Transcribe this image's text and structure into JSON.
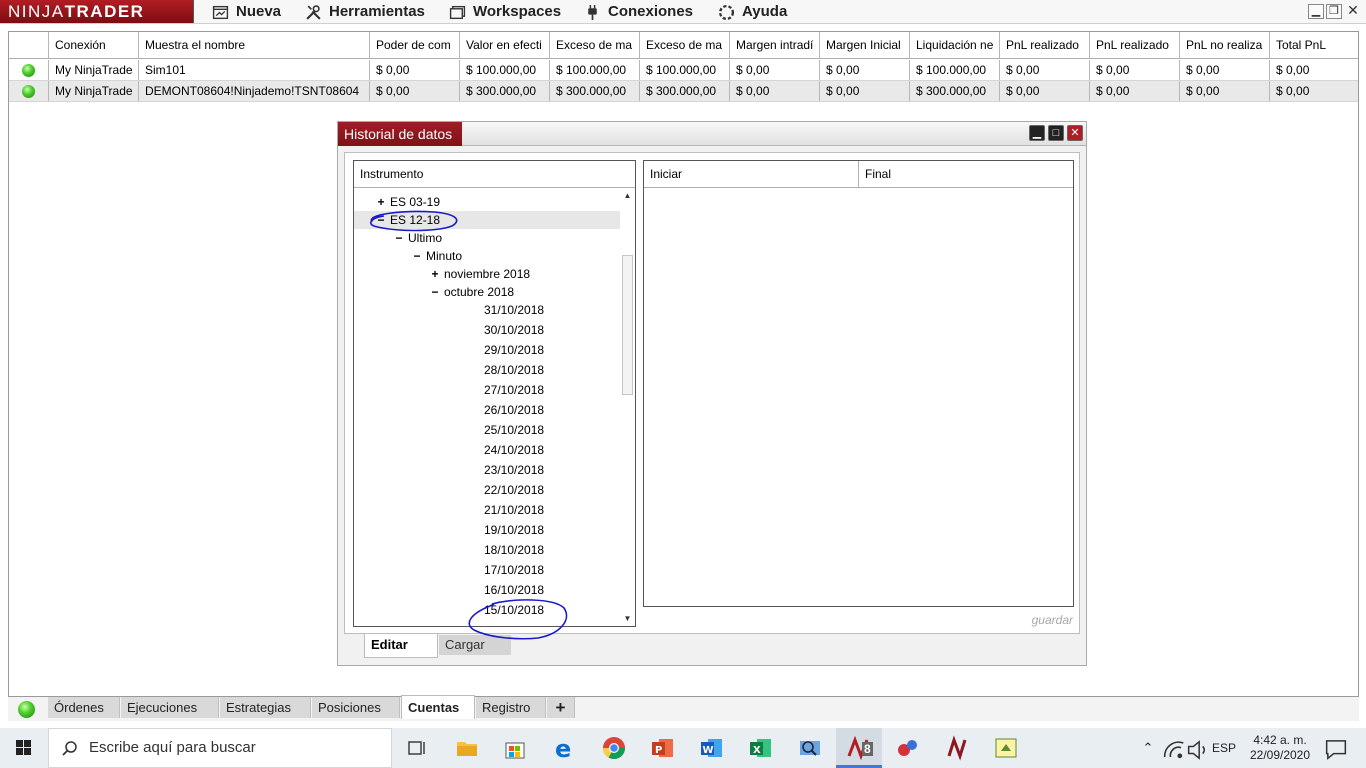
{
  "app": {
    "logo_light": "NINJA",
    "logo_bold": "TRADER",
    "menu": [
      "Nueva",
      "Herramientas",
      "Workspaces",
      "Conexiones",
      "Ayuda"
    ],
    "window_controls": [
      "minimize",
      "restore",
      "close"
    ]
  },
  "accounts": {
    "columns": [
      "",
      "Conexión",
      "Muestra el nombre",
      "Poder de com",
      "Valor en efecti",
      "Exceso de ma",
      "Exceso de ma",
      "Margen intradí",
      "Margen Inicial",
      "Liquidación ne",
      "PnL realizado",
      "PnL realizado",
      "PnL no realiza",
      "Total PnL"
    ],
    "rows": [
      [
        "",
        "My NinjaTrade",
        "Sim101",
        "$ 0,00",
        "$ 100.000,00",
        "$ 100.000,00",
        "$ 100.000,00",
        "$ 0,00",
        "$ 0,00",
        "$ 100.000,00",
        "$ 0,00",
        "$ 0,00",
        "$ 0,00",
        "$ 0,00"
      ],
      [
        "",
        "My NinjaTrade",
        "DEMONT08604!Ninjademo!TSNT08604",
        "$ 0,00",
        "$ 300.000,00",
        "$ 300.000,00",
        "$ 300.000,00",
        "$ 0,00",
        "$ 0,00",
        "$ 300.000,00",
        "$ 0,00",
        "$ 0,00",
        "$ 0,00",
        "$ 0,00"
      ]
    ],
    "status_color": "#3cc424"
  },
  "dialog": {
    "title": "Historial de datos",
    "tree_header": "Instrumento",
    "tree": [
      {
        "toggle": "+",
        "label": "ES 03-19"
      },
      {
        "toggle": "−",
        "label": "ES 12-18"
      },
      {
        "toggle": "−",
        "label": "Ultimo"
      },
      {
        "toggle": "−",
        "label": "Minuto"
      },
      {
        "toggle": "+",
        "label": "noviembre 2018"
      },
      {
        "toggle": "−",
        "label": "octubre 2018"
      },
      {
        "toggle": "",
        "label": "31/10/2018"
      },
      {
        "toggle": "",
        "label": "30/10/2018"
      },
      {
        "toggle": "",
        "label": "29/10/2018"
      },
      {
        "toggle": "",
        "label": "28/10/2018"
      },
      {
        "toggle": "",
        "label": "27/10/2018"
      },
      {
        "toggle": "",
        "label": "26/10/2018"
      },
      {
        "toggle": "",
        "label": "25/10/2018"
      },
      {
        "toggle": "",
        "label": "24/10/2018"
      },
      {
        "toggle": "",
        "label": "23/10/2018"
      },
      {
        "toggle": "",
        "label": "22/10/2018"
      },
      {
        "toggle": "",
        "label": "21/10/2018"
      },
      {
        "toggle": "",
        "label": "19/10/2018"
      },
      {
        "toggle": "",
        "label": "18/10/2018"
      },
      {
        "toggle": "",
        "label": "17/10/2018"
      },
      {
        "toggle": "",
        "label": "16/10/2018"
      },
      {
        "toggle": "",
        "label": "15/10/2018"
      }
    ],
    "range_header_start": "Iniciar",
    "range_header_end": "Final",
    "save_label": "guardar",
    "tab_edit": "Editar",
    "tab_load": "Cargar",
    "accent": "#8e1820",
    "annotation_color": "#1a1acc"
  },
  "bottom_tabs": [
    "Órdenes",
    "Ejecuciones",
    "Estrategias",
    "Posiciones",
    "Cuentas",
    "Registro",
    "+"
  ],
  "bottom_tabs_active": "Cuentas",
  "taskbar": {
    "search_placeholder": "Escribe aquí para buscar",
    "apps": [
      "task-view-icon",
      "file-explorer-icon",
      "store-icon",
      "edge-icon",
      "chrome-icon",
      "powerpoint-icon",
      "word-icon",
      "excel-icon",
      "search-app-icon",
      "ninjatrader-icon",
      "app-dots-icon",
      "ninjatrader-alt-icon",
      "app-arrow-icon"
    ],
    "running_badge": "8",
    "language": "ESP",
    "time": "4:42 a. m.",
    "date": "22/09/2020"
  }
}
